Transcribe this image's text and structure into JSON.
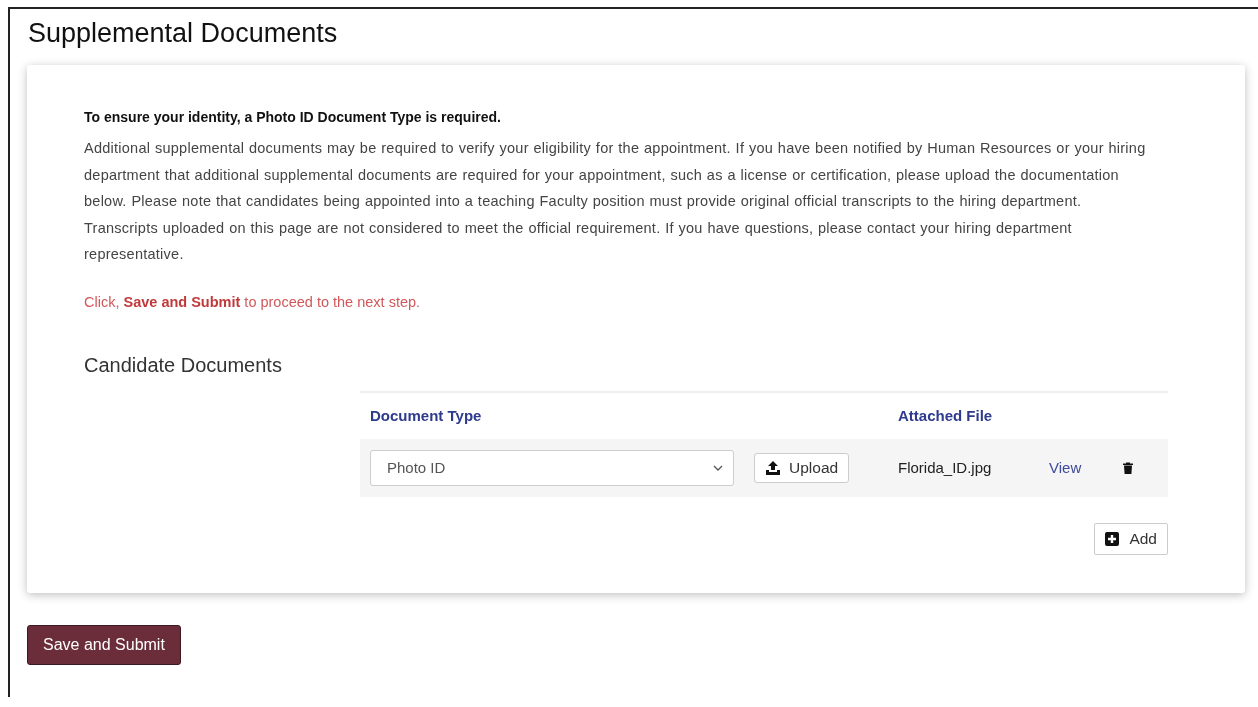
{
  "page_title": "Supplemental Documents",
  "notice": "To ensure your identity, a Photo ID Document Type is required.",
  "description": "Additional supplemental documents may be required to verify your eligibility for the appointment. If you have been notified by Human Resources or your hiring department that additional supplemental documents are required for your appointment, such as a license or certification, please upload the documentation below.  Please note that candidates being appointed into a teaching Faculty position must provide original official transcripts to the hiring department. Transcripts uploaded on this page are not considered to meet the official requirement.  If you have questions, please contact your hiring department representative.",
  "instruction": "Click, **Save and Submit** to proceed to the next step.",
  "section_title": "Candidate Documents",
  "table": {
    "columns": [
      "Document Type",
      "Attached File"
    ],
    "rows": [
      {
        "document_type": "Photo ID",
        "upload_label": "Upload",
        "attached_file": "Florida_ID.jpg",
        "view_label": "View"
      }
    ]
  },
  "add_label": "Add",
  "submit_label": "Save and Submit"
}
